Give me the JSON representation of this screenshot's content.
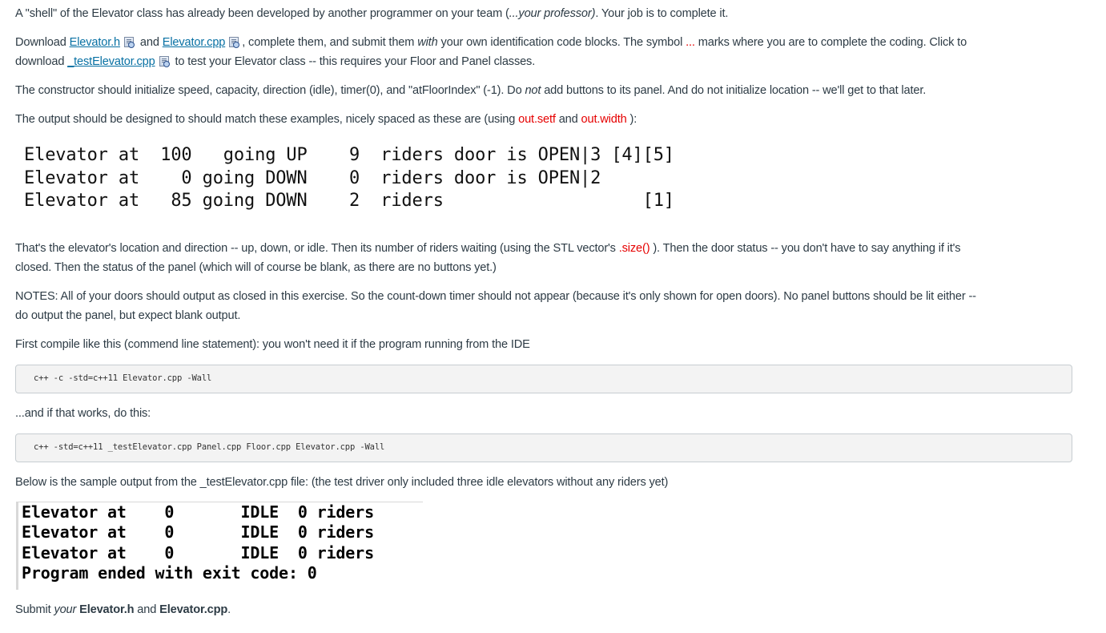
{
  "intro": {
    "text_before_italic": "A \"shell\" of the Elevator class has already been developed by another programmer on your team (",
    "italic": "...your professor)",
    "text_after_italic": ". Your job is to complete it."
  },
  "download": {
    "prefix": "Download ",
    "link_h": "Elevator.h",
    "and": " and ",
    "link_cpp": "Elevator.cpp",
    "after_cpp": ", complete them, and submit them ",
    "with_italic": "with",
    "after_with": " your own identification code blocks. The symbol ",
    "symbol": "...",
    "after_symbol": " marks where you are to complete the coding. Click to",
    "line2_prefix": "download ",
    "link_test": "_testElevator.cpp",
    "line2_suffix": " to test your Elevator class -- this requires your Floor and Panel classes.",
    "file_icon": "document-preview-icon"
  },
  "constructor": {
    "text1": "The constructor should initialize speed, capacity, direction (idle), timer(0), and \"atFloorIndex\" (-1). Do ",
    "not_italic": "not",
    "text2": " add buttons to its panel. And do not initialize location -- we'll get to that later."
  },
  "output_intro": {
    "text1": "The output should be designed to should match these examples, nicely spaced as these are (using ",
    "setf": "out.setf",
    "and": " and ",
    "width": "out.width",
    "text2": " ):"
  },
  "example_output": [
    "Elevator at  100   going UP    9  riders door is OPEN|3 [4][5]",
    "Elevator at    0 going DOWN    0  riders door is OPEN|2",
    "Elevator at   85 going DOWN    2  riders                   [1]"
  ],
  "explanation": {
    "line1_a": "That's the elevator's location and direction -- up, down, or idle. Then its number of riders waiting (using the STL vector's ",
    "size": ".size()",
    "line1_b": " ). Then the door status -- you don't have to say anything if it's",
    "line2": "closed. Then the status of the panel (which will of course be blank, as there are no buttons yet.)"
  },
  "notes": {
    "line1": "NOTES: All of your doors should output as closed in this exercise. So the count-down timer should not appear (because it's only shown for open doors). No panel buttons should be lit either --",
    "line2": "do output the panel, but expect blank output."
  },
  "compile": {
    "intro": "First compile like this (commend line statement): you won't need it if the program running from the IDE",
    "command1": "c++ -c -std=c++11 Elevator.cpp -Wall",
    "then": "...and if that works, do this:",
    "command2": "c++ -std=c++11 _testElevator.cpp Panel.cpp Floor.cpp Elevator.cpp -Wall"
  },
  "sample": {
    "intro": "Below is the sample output from the _testElevator.cpp file: (the test driver only included three idle elevators without any riders yet)",
    "lines": [
      "Elevator at    0       IDLE  0 riders",
      "Elevator at    0       IDLE  0 riders",
      "Elevator at    0       IDLE  0 riders",
      "Program ended with exit code: 0"
    ]
  },
  "submit": {
    "prefix": "Submit ",
    "your": "your",
    "file_h": "Elevator.h",
    "and": " and ",
    "file_cpp": "Elevator.cpp",
    "period": "."
  },
  "colors": {
    "text": "#2d3b45",
    "link": "#0770a3",
    "highlight_red": "#e60000",
    "code_bg": "#f3f3f3"
  }
}
